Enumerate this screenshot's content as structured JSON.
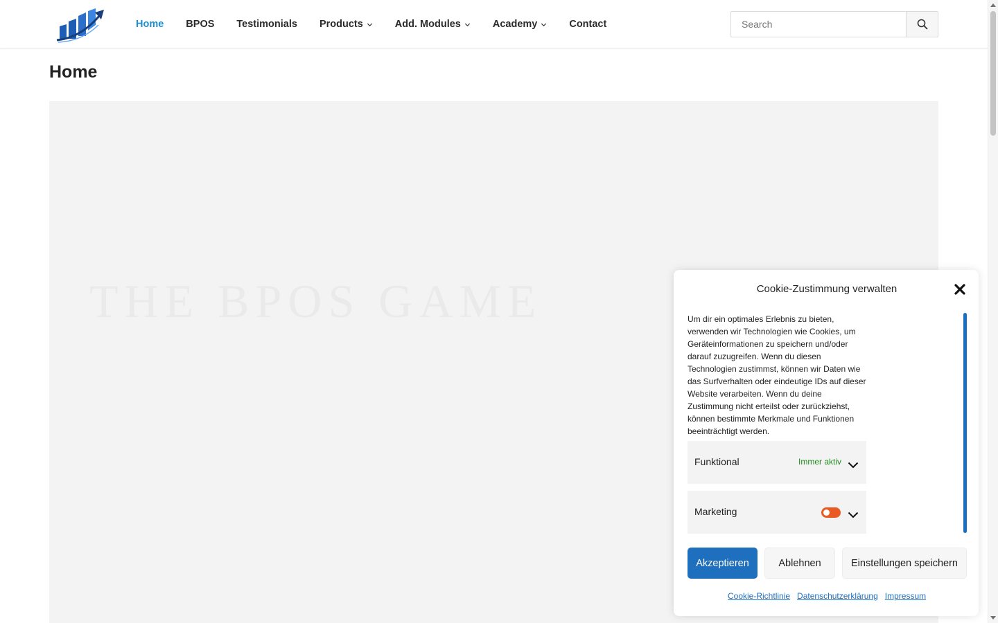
{
  "header": {
    "logo_icon": "bpos-chart-logo",
    "nav": [
      {
        "label": "Home",
        "active": true
      },
      {
        "label": "BPOS"
      },
      {
        "label": "Testimonials"
      },
      {
        "label": "Products",
        "dropdown": true
      },
      {
        "label": "Add. Modules",
        "dropdown": true
      },
      {
        "label": "Academy",
        "dropdown": true
      },
      {
        "label": "Contact"
      }
    ],
    "search": {
      "placeholder": "Search",
      "icon": "search-icon"
    }
  },
  "page": {
    "title": "Home",
    "hero_text": "THE BPOS GAME"
  },
  "cookie": {
    "title": "Cookie-Zustimmung verwalten",
    "body": "Um dir ein optimales Erlebnis zu bieten, verwenden wir Technologien wie Cookies, um Geräteinformationen zu speichern und/oder darauf zuzugreifen. Wenn du diesen Technologien zustimmst, können wir Daten wie das Surfverhalten oder eindeutige IDs auf dieser Website verarbeiten. Wenn du deine Zustimmung nicht erteilst oder zurückziehst, können bestimmte Merkmale und Funktionen beeinträchtigt werden.",
    "categories": [
      {
        "label": "Funktional",
        "status": "Immer aktiv"
      },
      {
        "label": "Marketing",
        "toggle": "off"
      }
    ],
    "buttons": {
      "accept": "Akzeptieren",
      "deny": "Ablehnen",
      "save": "Einstellungen speichern"
    },
    "links": [
      "Cookie-Richtlinie",
      "Datenschutzerklärung",
      "Impressum"
    ]
  },
  "colors": {
    "nav_active": "#1a8fd6",
    "accept_button": "#1e6fbe",
    "always_active": "#1e8a1e",
    "toggle_off": "#ea5b24"
  }
}
